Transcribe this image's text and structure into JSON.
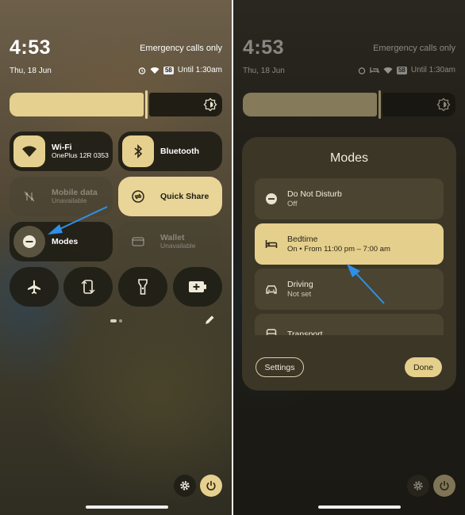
{
  "left": {
    "time": "4:53",
    "date": "Thu, 18 Jun",
    "emergency": "Emergency calls only",
    "battery": "58",
    "alarm_status": "Until 1:30am",
    "brightness_level": 0.63,
    "tiles": {
      "wifi": {
        "title": "Wi-Fi",
        "subtitle": "OnePlus 12R 0353"
      },
      "bluetooth": {
        "title": "Bluetooth"
      },
      "mobile_data": {
        "title": "Mobile data",
        "subtitle": "Unavailable"
      },
      "quick_share": {
        "title": "Quick Share"
      },
      "modes": {
        "title": "Modes"
      },
      "wallet": {
        "title": "Wallet",
        "subtitle": "Unavailable"
      }
    },
    "round_tiles": [
      "airplane-icon",
      "auto-rotate-icon",
      "flashlight-icon",
      "battery-saver-icon"
    ],
    "page_indicator": {
      "pages": 2,
      "current": 1
    }
  },
  "right": {
    "time": "4:53",
    "date": "Thu, 18 Jun",
    "emergency": "Emergency calls only",
    "battery": "58",
    "alarm_status": "Until 1:30am",
    "dialog": {
      "title": "Modes",
      "modes": [
        {
          "name": "Do Not Disturb",
          "status": "Off",
          "icon": "do-not-disturb-icon",
          "active": false
        },
        {
          "name": "Bedtime",
          "status": "On • From 11:00 pm – 7:00 am",
          "icon": "bed-icon",
          "active": true
        },
        {
          "name": "Driving",
          "status": "Not set",
          "icon": "car-icon",
          "active": false
        },
        {
          "name": "Transport",
          "status": "",
          "icon": "bus-icon",
          "active": false
        }
      ],
      "settings_label": "Settings",
      "done_label": "Done"
    }
  },
  "colors": {
    "accent": "#e5d08f",
    "tile_dark": "#201e16",
    "dialog_bg": "#3b3626",
    "mode_item": "#4a4430",
    "annotation_arrow": "#2f8fe6"
  }
}
